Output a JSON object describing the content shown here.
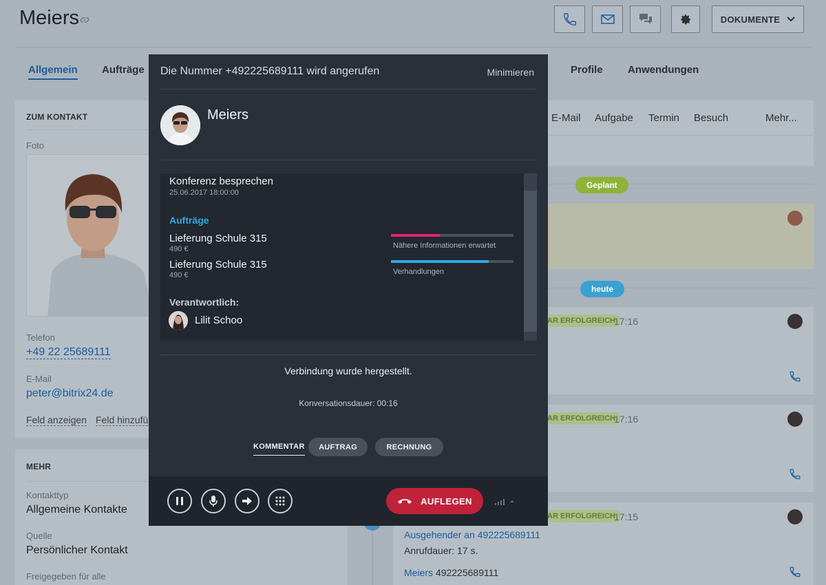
{
  "page": {
    "title": "Meiers",
    "header_buttons": {
      "documents_label": "DOKUMENTE"
    },
    "tabs": [
      "Allgemein",
      "Aufträge",
      "Profile",
      "Anwendungen"
    ],
    "activity_tabs": [
      "E-Mail",
      "Aufgabe",
      "Termin",
      "Besuch",
      "Mehr..."
    ]
  },
  "contact_card": {
    "title": "ZUM KONTAKT",
    "photo_label": "Foto",
    "phone_label": "Telefon",
    "phone_value": "+49 22 25689111",
    "email_label": "E-Mail",
    "email_value": "peter@bitrix24.de",
    "show_field": "Feld anzeigen",
    "add_field": "Feld hinzufü"
  },
  "more_card": {
    "title": "MEHR",
    "contact_type_label": "Kontakttyp",
    "contact_type_value": "Allgemeine Kontakte",
    "source_label": "Quelle",
    "source_value": "Persönlicher Kontakt",
    "shared_label": "Freigegeben für alle"
  },
  "timeline": {
    "planned_label": "Geplant",
    "today_label": "heute",
    "items": [
      {
        "status": "AR ERFOLGREICH",
        "time": "17:16"
      },
      {
        "status": "AR ERFOLGREICH",
        "time": "17:16"
      },
      {
        "status": "AR ERFOLGREICH",
        "time": "17:15",
        "line1": "Ausgehender an 492225689111",
        "line2": "Anrufdauer: 17 s.",
        "line3_name": "Meiers",
        "line3_number": "492225689111"
      }
    ]
  },
  "call_modal": {
    "title": "Die Nummer +492225689111 wird angerufen",
    "minimize": "Minimieren",
    "contact_name": "Meiers",
    "event": {
      "title": "Konferenz besprechen",
      "date": "25.06.2017 18:00:00"
    },
    "orders_heading": "Aufträge",
    "orders": [
      {
        "name": "Lieferung Schule 315",
        "amount": "490 €",
        "stage": "Nähere Informationen erwartet",
        "progress": 0.4,
        "color": "#e0247a"
      },
      {
        "name": "Lieferung Schule 315",
        "amount": "490 €",
        "stage": "Verhandlungen",
        "progress": 0.8,
        "color": "#2fa9df"
      }
    ],
    "responsible_heading": "Verantwortlich:",
    "responsible_name": "Lilit Schoo",
    "status_message": "Verbindung wurde hergestellt.",
    "duration": "Konversationsdauer: 00:16",
    "tabs": [
      "KOMMENTAR",
      "AUFTRAG",
      "RECHNUNG"
    ],
    "hangup_label": "AUFLEGEN"
  },
  "colors": {
    "accent": "#1b5c9b",
    "hangup": "#c0223a",
    "modal_bg": "#2a303a"
  }
}
